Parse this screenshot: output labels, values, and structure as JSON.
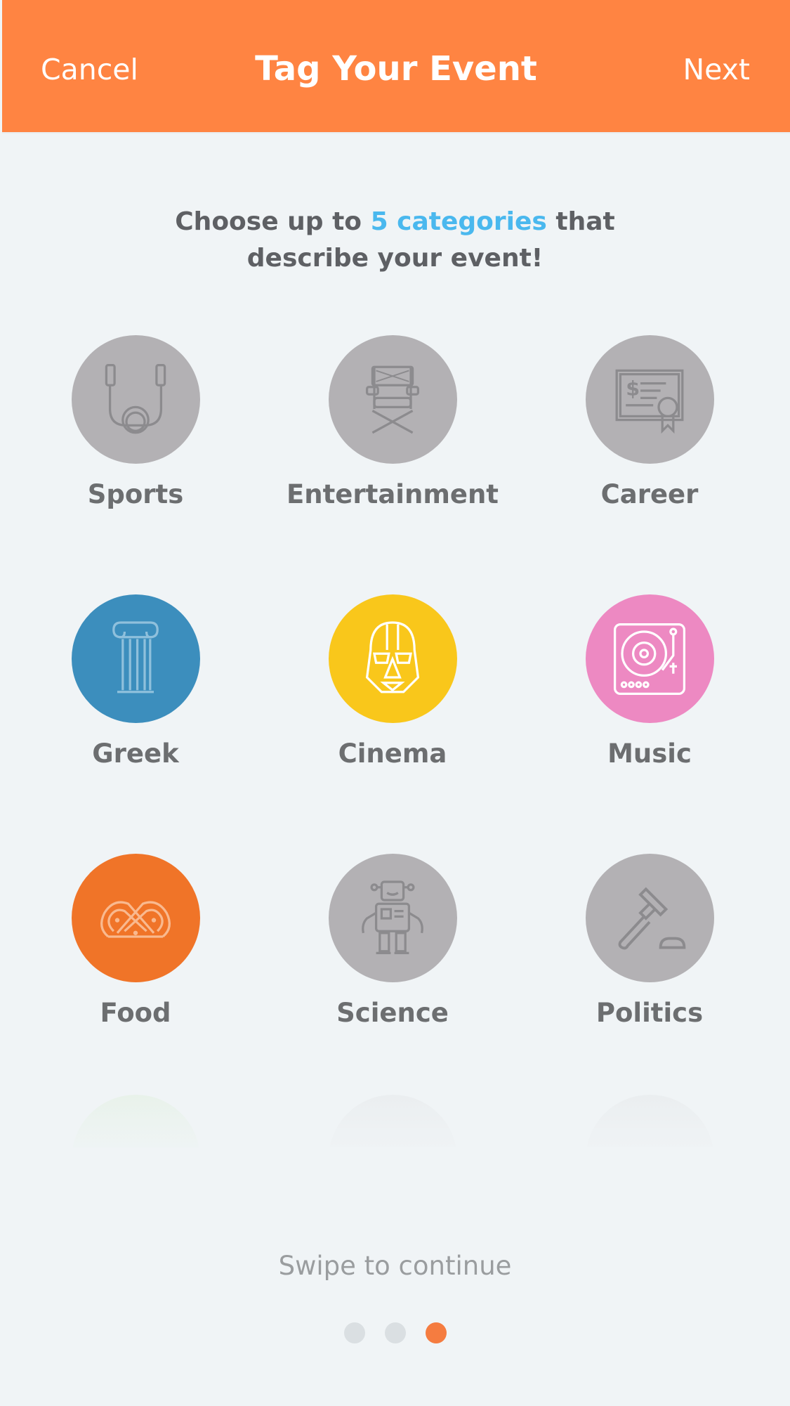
{
  "header": {
    "cancel_label": "Cancel",
    "title": "Tag Your Event",
    "next_label": "Next"
  },
  "intro": {
    "before": "Choose up to ",
    "highlight": "5 categories",
    "after": " that",
    "line2": "describe your event!"
  },
  "categories": [
    {
      "label": "Sports",
      "icon": "jump-rope-icon",
      "selected": false,
      "color": "#b3b1b4"
    },
    {
      "label": "Entertainment",
      "icon": "directors-chair-icon",
      "selected": false,
      "color": "#b3b1b4"
    },
    {
      "label": "Career",
      "icon": "certificate-icon",
      "selected": false,
      "color": "#b3b1b4"
    },
    {
      "label": "Greek",
      "icon": "column-icon",
      "selected": true,
      "color": "#3c8ebd"
    },
    {
      "label": "Cinema",
      "icon": "darth-vader-icon",
      "selected": true,
      "color": "#f9c71b"
    },
    {
      "label": "Music",
      "icon": "turntable-icon",
      "selected": true,
      "color": "#ed89c2"
    },
    {
      "label": "Food",
      "icon": "pretzel-icon",
      "selected": true,
      "color": "#f07428"
    },
    {
      "label": "Science",
      "icon": "robot-icon",
      "selected": false,
      "color": "#b3b1b4"
    },
    {
      "label": "Politics",
      "icon": "gavel-icon",
      "selected": false,
      "color": "#b3b1b4"
    }
  ],
  "footer": {
    "swipe_text": "Swipe to continue",
    "page_count": 3,
    "active_page": 3
  },
  "colors": {
    "header": "#ff8442",
    "accent_text": "#4ab8ee",
    "unselected": "#b3b1b4"
  }
}
